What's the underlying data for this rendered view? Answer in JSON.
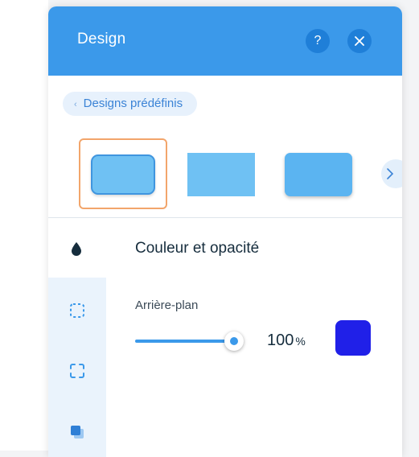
{
  "panel": {
    "title": "Design",
    "help_label": "?",
    "presets_link": "Designs prédéfinis"
  },
  "presets": {
    "items": [
      "rounded-bordered",
      "flat",
      "rounded-shadow"
    ],
    "selected_index": 0
  },
  "sidebar": {
    "items": [
      "fill-drop-icon",
      "border-dashed-icon",
      "corners-icon",
      "shadow-icon"
    ],
    "active": "fill-drop-icon"
  },
  "section": {
    "title": "Couleur et opacité",
    "background_label": "Arrière-plan",
    "opacity_value": "100",
    "opacity_unit": "%",
    "opacity_fraction": 1.0,
    "color": "#2020e8"
  },
  "colors": {
    "header": "#3b99ea",
    "accent": "#3b99ea",
    "selection_border": "#f2a56b"
  }
}
